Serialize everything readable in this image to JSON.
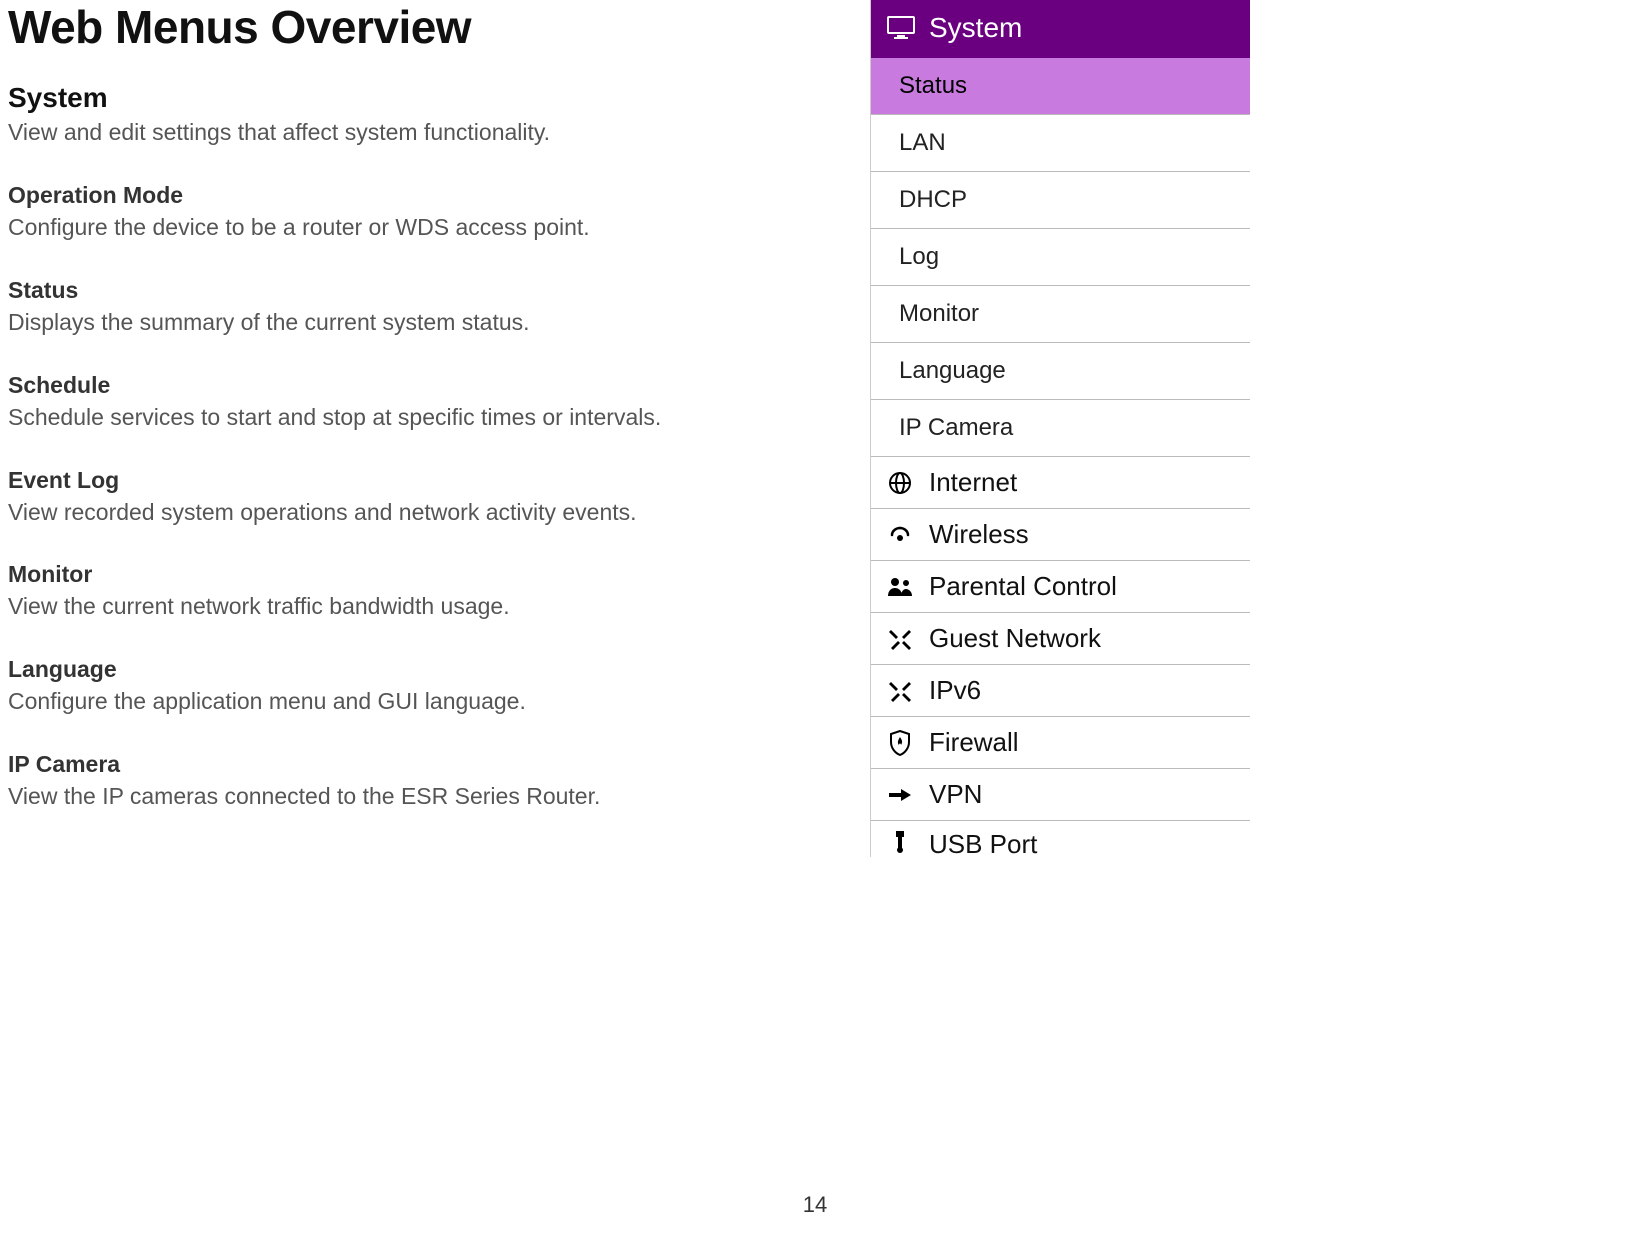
{
  "page": {
    "title": "Web Menus Overview",
    "number": "14"
  },
  "section": {
    "heading": "System",
    "desc": "View and edit settings that affect system functionality.",
    "items": [
      {
        "title": "Operation Mode",
        "desc": "Configure the device to be a router or WDS access point."
      },
      {
        "title": "Status",
        "desc": "Displays the summary of the current system status."
      },
      {
        "title": "Schedule",
        "desc": "Schedule services to start and stop at specific times or intervals."
      },
      {
        "title": "Event Log",
        "desc": "View recorded system operations and network activity events."
      },
      {
        "title": "Monitor",
        "desc": "View the current network traffic bandwidth usage."
      },
      {
        "title": "Language",
        "desc": "Configure the application menu and GUI language."
      },
      {
        "title": "IP Camera",
        "desc": "View the IP cameras connected to the ESR Series Router."
      }
    ]
  },
  "nav": {
    "header": "System",
    "subitems": [
      {
        "label": "Status",
        "active": true
      },
      {
        "label": "LAN",
        "active": false
      },
      {
        "label": "DHCP",
        "active": false
      },
      {
        "label": "Log",
        "active": false
      },
      {
        "label": "Monitor",
        "active": false
      },
      {
        "label": "Language",
        "active": false
      },
      {
        "label": "IP Camera",
        "active": false
      }
    ],
    "categories": [
      {
        "label": "Internet",
        "icon": "globe"
      },
      {
        "label": "Wireless",
        "icon": "wifi"
      },
      {
        "label": "Parental Control",
        "icon": "users"
      },
      {
        "label": "Guest Network",
        "icon": "tools"
      },
      {
        "label": "IPv6",
        "icon": "tools"
      },
      {
        "label": "Firewall",
        "icon": "shield-fire"
      },
      {
        "label": "VPN",
        "icon": "arrow-right"
      },
      {
        "label": "USB Port",
        "icon": "usb",
        "cut": true
      }
    ]
  }
}
